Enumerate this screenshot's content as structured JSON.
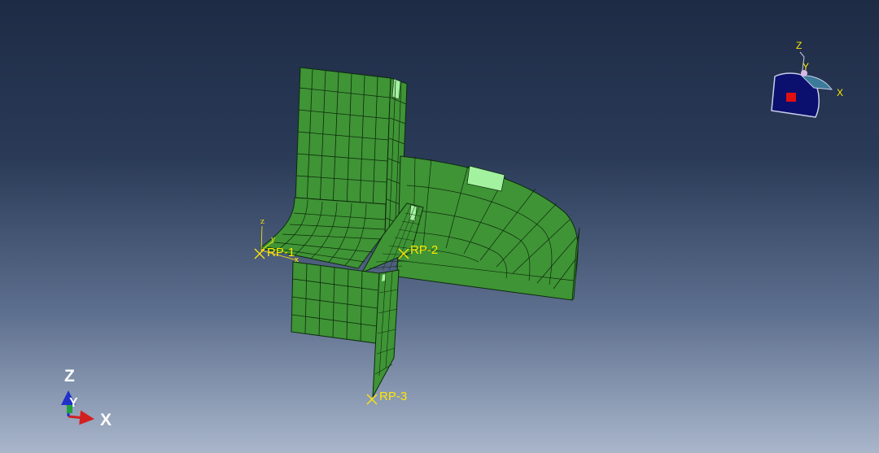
{
  "viewport": {
    "reference_points": [
      {
        "id": "rp1",
        "label": "RP-1"
      },
      {
        "id": "rp2",
        "label": "RP-2"
      },
      {
        "id": "rp3",
        "label": "RP-3"
      }
    ],
    "global_triad": {
      "z": "Z",
      "y": "Y",
      "x": "X"
    },
    "local_triad": {
      "z": "z",
      "y": "y",
      "x": "x"
    },
    "view_cube": {
      "z": "Z",
      "y": "Y",
      "x": "X"
    }
  },
  "colors": {
    "mesh_fill": "#3f9436",
    "mesh_highlight": "#a3f2a0",
    "mesh_edge": "#0d2a0b",
    "rp_marker": "#ffe800",
    "background_top": "#1e2b45",
    "background_bottom": "#a9b6cb",
    "view_cube_face": "#0b0f6e",
    "axis_x": "#d22020",
    "axis_y": "#20a040",
    "axis_z": "#2030c8"
  }
}
